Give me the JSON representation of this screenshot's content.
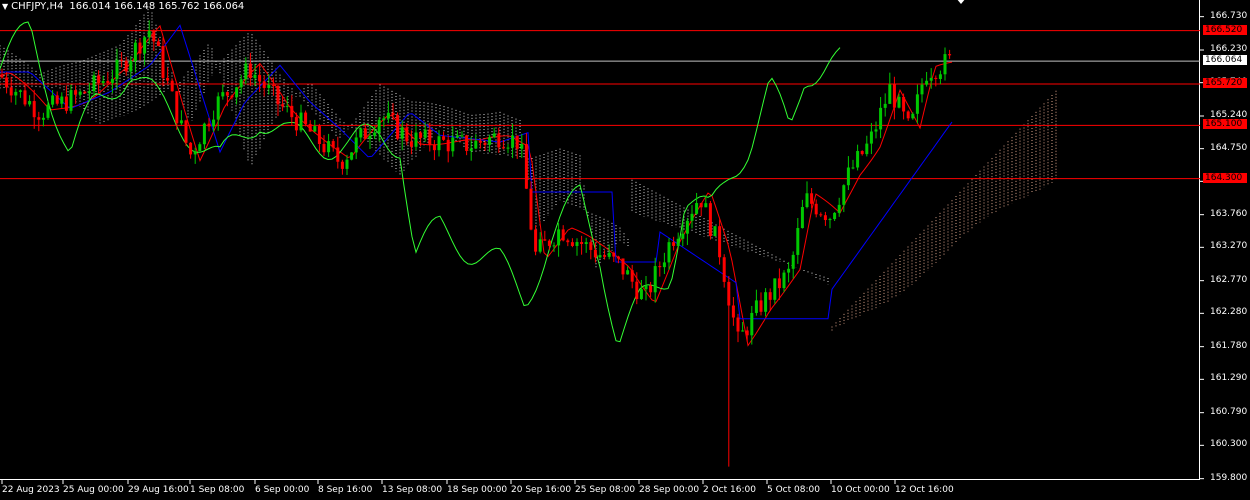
{
  "header": {
    "symbol": "CHFJPY,H4",
    "ohlc": "166.014 166.148 165.762 166.064"
  },
  "chart_data": {
    "type": "candlestick",
    "ylim": [
      159.78,
      166.98
    ],
    "y_ticks": [
      "166.730",
      "166.230",
      "165.740",
      "165.240",
      "164.750",
      "164.260",
      "163.760",
      "163.270",
      "162.770",
      "162.280",
      "161.780",
      "161.290",
      "160.790",
      "160.300",
      "159.800"
    ],
    "x_ticks": [
      "22 Aug 2023",
      "25 Aug 00:00",
      "29 Aug 16:00",
      "1 Sep 08:00",
      "6 Sep 00:00",
      "8 Sep 16:00",
      "13 Sep 08:00",
      "18 Sep 00:00",
      "20 Sep 16:00",
      "25 Sep 08:00",
      "28 Sep 00:00",
      "2 Oct 16:00",
      "5 Oct 08:00",
      "10 Oct 00:00",
      "12 Oct 16:00"
    ],
    "levels": [
      {
        "value": 166.52,
        "label": "166.520",
        "color": "#ff0000",
        "style": "red"
      },
      {
        "value": 166.064,
        "label": "166.064",
        "color": "#c0c0c0",
        "style": "current"
      },
      {
        "value": 165.72,
        "label": "165.720",
        "color": "#ff0000",
        "style": "red"
      },
      {
        "value": 165.1,
        "label": "165.100",
        "color": "#ff0000",
        "style": "red"
      },
      {
        "value": 164.3,
        "label": "164.300",
        "color": "#ff0000",
        "style": "red"
      }
    ],
    "colors": {
      "bull": "#00c800",
      "bear": "#ff0000",
      "tenkan": "#ff0000",
      "kijun": "#0000ff",
      "chikou": "#33ff33",
      "cloud_bear": "#ffffff",
      "cloud_bull": "#ffbfa0",
      "background": "#000000",
      "grid": "none"
    },
    "series": [
      {
        "name": "price",
        "values": [
          [
            0,
            165.85
          ],
          [
            40,
            165.3
          ],
          [
            80,
            165.55
          ],
          [
            120,
            165.95
          ],
          [
            150,
            166.55
          ],
          [
            170,
            165.6
          ],
          [
            190,
            164.65
          ],
          [
            215,
            165.4
          ],
          [
            250,
            165.95
          ],
          [
            280,
            165.4
          ],
          [
            310,
            165.0
          ],
          [
            340,
            164.55
          ],
          [
            380,
            165.25
          ],
          [
            410,
            164.9
          ],
          [
            440,
            164.85
          ],
          [
            470,
            164.8
          ],
          [
            500,
            164.95
          ],
          [
            520,
            164.85
          ],
          [
            535,
            163.15
          ],
          [
            560,
            163.55
          ],
          [
            590,
            163.25
          ],
          [
            620,
            163.0
          ],
          [
            645,
            162.5
          ],
          [
            670,
            163.35
          ],
          [
            700,
            164.05
          ],
          [
            720,
            163.2
          ],
          [
            738,
            161.85
          ],
          [
            760,
            162.4
          ],
          [
            790,
            162.9
          ],
          [
            805,
            164.0
          ],
          [
            830,
            163.75
          ],
          [
            850,
            164.4
          ],
          [
            870,
            164.85
          ],
          [
            890,
            165.65
          ],
          [
            910,
            165.0
          ],
          [
            925,
            165.9
          ],
          [
            950,
            166.06
          ]
        ]
      }
    ]
  }
}
